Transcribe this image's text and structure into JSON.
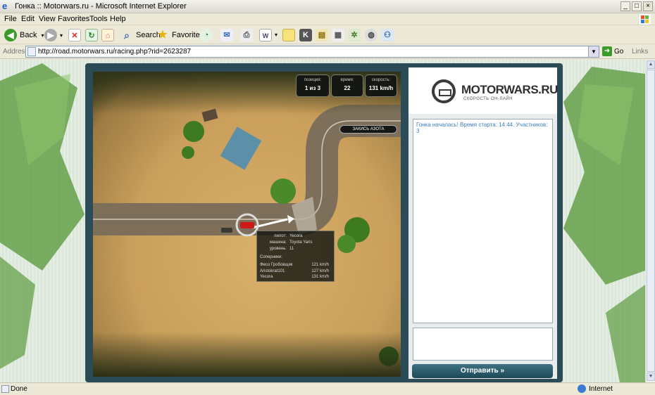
{
  "window": {
    "title": "Гонка :: Motorwars.ru - Microsoft Internet Explorer",
    "minimize": "_",
    "restore": "□",
    "close": "×"
  },
  "menu": {
    "items": [
      "File",
      "Edit",
      "View",
      "Favorites",
      "Tools",
      "Help"
    ]
  },
  "toolbar": {
    "back_label": "Back",
    "search_label": "Search",
    "favorites_label": "Favorites"
  },
  "address": {
    "label": "Address",
    "url": "http://road.motorwars.ru/racing.php?rid=2623287",
    "go_label": "Go",
    "links_label": "Links"
  },
  "hud": {
    "position_label": "позиция:",
    "position_value": "1 из 3",
    "time_label": "время:",
    "time_value": "22",
    "speed_label": "скорость:",
    "speed_value": "131 km/h",
    "nitro_label": "ЗАКИСЬ АЗОТА"
  },
  "tooltip": {
    "pilot_key": "пилот:",
    "pilot_value": "Yecora",
    "car_key": "машина:",
    "car_value": "Toyota Yaris",
    "level_key": "уровень:",
    "level_value": "11",
    "rivals_header": "Соперники:",
    "rivals": [
      {
        "name": "Фесо Гробовщик",
        "speed": "121 km/h"
      },
      {
        "name": "Aristokrat101",
        "speed": "127 km/h"
      },
      {
        "name": "Yecora",
        "speed": "131 km/h"
      }
    ]
  },
  "logo": {
    "title": "MOTORWARS.RU",
    "subtitle": "СКОРОСТЬ ОН-ЛАЙН"
  },
  "chat": {
    "message": "Гонка началась! Время старта: 14:44. Участников: 3",
    "send_label": "Отправить »"
  },
  "status": {
    "text": "Done",
    "zone": "Internet"
  }
}
